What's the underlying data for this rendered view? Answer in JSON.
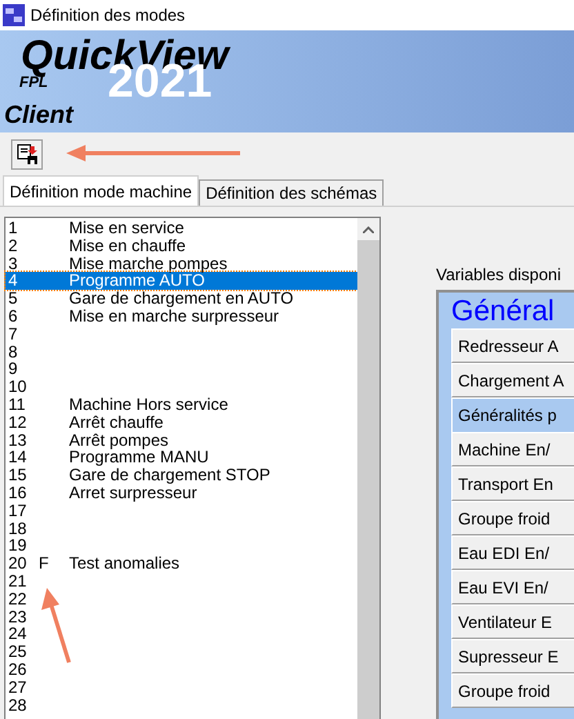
{
  "window": {
    "title": "Définition des modes"
  },
  "banner": {
    "product": "QuickView",
    "edition": "FPL",
    "year": "2021",
    "subtitle": "Client"
  },
  "tabs": [
    {
      "label": "Définition mode machine",
      "selected": true
    },
    {
      "label": "Définition des schémas",
      "selected": false
    }
  ],
  "modes": [
    {
      "number": "1",
      "label": "Mise en service",
      "selected": false
    },
    {
      "number": "2",
      "label": "Mise en chauffe",
      "selected": false
    },
    {
      "number": "3",
      "label": "Mise marche pompes",
      "selected": false
    },
    {
      "number": "4",
      "label": "Programme AUTO",
      "selected": true
    },
    {
      "number": "5",
      "label": "Gare de chargement en AUTO",
      "selected": false
    },
    {
      "number": "6",
      "label": "Mise en marche surpresseur",
      "selected": false
    },
    {
      "number": "7",
      "selected": false
    },
    {
      "number": "8",
      "selected": false
    },
    {
      "number": "9",
      "selected": false
    },
    {
      "number": "10",
      "selected": false
    },
    {
      "number": "11",
      "label": "Machine Hors service",
      "selected": false
    },
    {
      "number": "12",
      "label": "Arrêt chauffe",
      "selected": false
    },
    {
      "number": "13",
      "label": "Arrêt pompes",
      "selected": false
    },
    {
      "number": "14",
      "label": "Programme MANU",
      "selected": false
    },
    {
      "number": "15",
      "label": "Gare de chargement STOP",
      "selected": false
    },
    {
      "number": "16",
      "label": "Arret surpresseur",
      "selected": false
    },
    {
      "number": "17",
      "selected": false
    },
    {
      "number": "18",
      "selected": false
    },
    {
      "number": "19",
      "selected": false
    },
    {
      "number": "20",
      "flag": "F",
      "label": "Test anomalies",
      "selected": false
    },
    {
      "number": "21",
      "selected": false
    },
    {
      "number": "22",
      "selected": false
    },
    {
      "number": "23",
      "selected": false
    },
    {
      "number": "24",
      "selected": false
    },
    {
      "number": "25",
      "selected": false
    },
    {
      "number": "26",
      "selected": false
    },
    {
      "number": "27",
      "selected": false
    },
    {
      "number": "28",
      "selected": false
    }
  ],
  "variables": {
    "label": "Variables disponi",
    "group_title": "Général",
    "items": [
      {
        "label": "Redresseur A",
        "selected": false
      },
      {
        "label": "Chargement A",
        "selected": false
      },
      {
        "label": "Généralités p",
        "selected": true
      },
      {
        "label": "Machine En/",
        "selected": false
      },
      {
        "label": "Transport En",
        "selected": false
      },
      {
        "label": "Groupe froid",
        "selected": false
      },
      {
        "label": "Eau EDI En/",
        "selected": false
      },
      {
        "label": "Eau EVI En/",
        "selected": false
      },
      {
        "label": "Ventilateur E",
        "selected": false
      },
      {
        "label": "Supresseur E",
        "selected": false
      },
      {
        "label": "Groupe froid",
        "selected": false
      }
    ]
  }
}
